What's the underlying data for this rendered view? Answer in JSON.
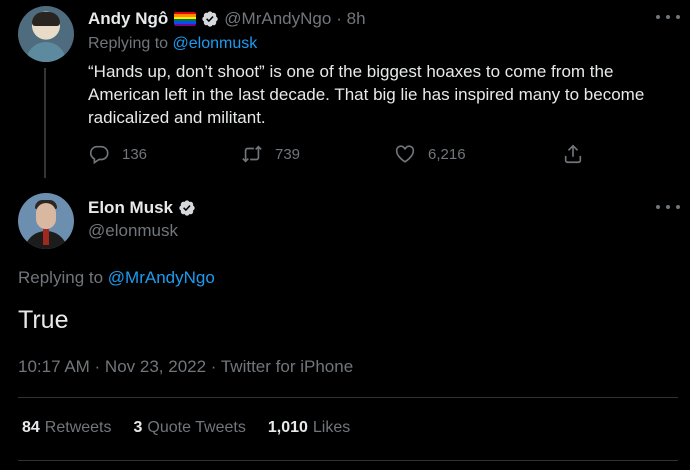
{
  "tweet1": {
    "author_name": "Andy Ngô",
    "handle": "@MrAndyNgo",
    "time": "· 8h",
    "replying_prefix": "Replying to ",
    "replying_to": "@elonmusk",
    "text": "“Hands up, don’t shoot” is one of the biggest hoaxes to come from the American left in the last decade. That big lie has inspired many to become radicalized and militant.",
    "replies": "136",
    "retweets": "739",
    "likes": "6,216",
    "icons": {
      "reply": "reply-icon",
      "retweet": "retweet-icon",
      "like": "heart-icon",
      "share": "share-icon",
      "flag": "rainbow-flag-icon",
      "verified": "verified-badge-icon"
    }
  },
  "tweet2": {
    "author_name": "Elon Musk",
    "handle": "@elonmusk",
    "replying_prefix": "Replying to ",
    "replying_to": "@MrAndyNgo",
    "text": "True",
    "timestamp": "10:17 AM · Nov 23, 2022 · Twitter for iPhone",
    "stats": {
      "retweets_count": "84",
      "retweets_label": "Retweets",
      "quotes_count": "3",
      "quotes_label": "Quote Tweets",
      "likes_count": "1,010",
      "likes_label": "Likes"
    }
  },
  "colors": {
    "background": "#000000",
    "text": "#e7e9ea",
    "muted": "#71767b",
    "link": "#1d9bf0",
    "verified": "#d6d9db"
  }
}
